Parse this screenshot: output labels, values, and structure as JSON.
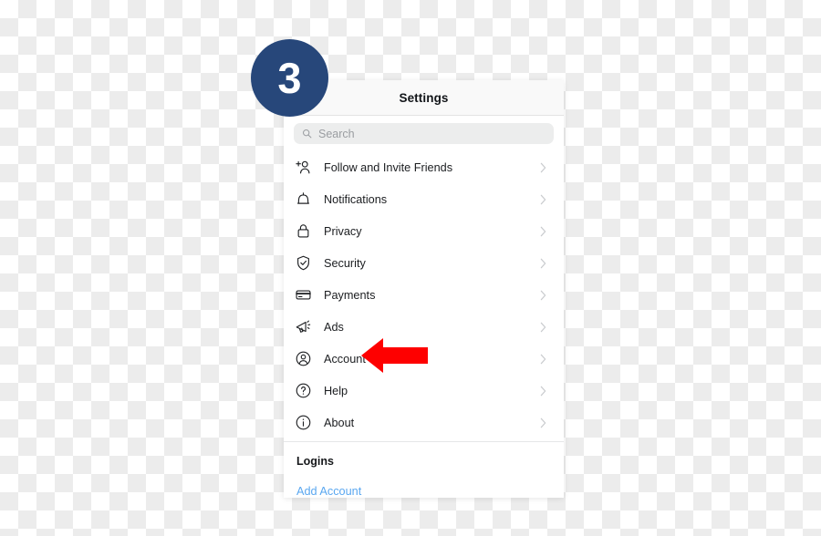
{
  "step_badge": {
    "number": "3",
    "color": "#27477a"
  },
  "panel": {
    "header": {
      "title": "Settings"
    },
    "search": {
      "placeholder": "Search",
      "value": "",
      "icon": "search-icon"
    },
    "items": [
      {
        "label": "Follow and Invite Friends",
        "icon": "person-add-icon",
        "chevron": "chevron-right-icon"
      },
      {
        "label": "Notifications",
        "icon": "bell-icon",
        "chevron": "chevron-right-icon"
      },
      {
        "label": "Privacy",
        "icon": "lock-icon",
        "chevron": "chevron-right-icon"
      },
      {
        "label": "Security",
        "icon": "shield-check-icon",
        "chevron": "chevron-right-icon"
      },
      {
        "label": "Payments",
        "icon": "credit-card-icon",
        "chevron": "chevron-right-icon"
      },
      {
        "label": "Ads",
        "icon": "megaphone-icon",
        "chevron": "chevron-right-icon"
      },
      {
        "label": "Account",
        "icon": "person-circle-icon",
        "chevron": "chevron-right-icon"
      },
      {
        "label": "Help",
        "icon": "question-circle-icon",
        "chevron": "chevron-right-icon"
      },
      {
        "label": "About",
        "icon": "info-circle-icon",
        "chevron": "chevron-right-icon"
      }
    ],
    "logins_section": {
      "title": "Logins",
      "add_account_label": "Add Account",
      "link_color": "#5aa7f0"
    }
  },
  "annotation": {
    "arrow": {
      "name": "red-arrow-pointer",
      "direction": "left",
      "color": "#fe0000",
      "points_at": "Account"
    }
  }
}
